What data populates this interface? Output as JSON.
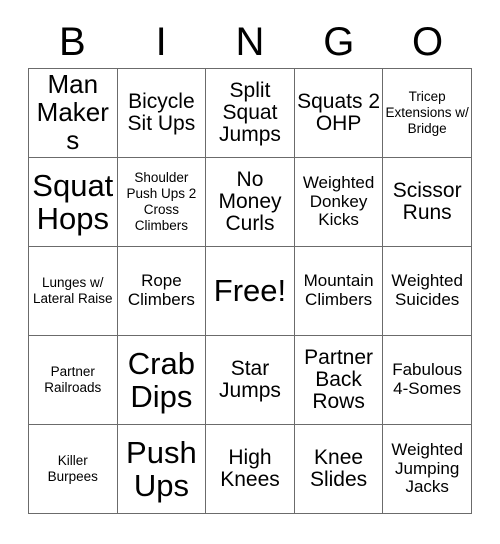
{
  "card": {
    "header_letters": [
      "B",
      "I",
      "N",
      "G",
      "O"
    ],
    "rows": [
      [
        {
          "label": "Man Makers",
          "size": "lg"
        },
        {
          "label": "Bicycle Sit Ups",
          "size": "md"
        },
        {
          "label": "Split Squat Jumps",
          "size": "md"
        },
        {
          "label": "Squats 2 OHP",
          "size": "md"
        },
        {
          "label": "Tricep Extensions w/ Bridge",
          "size": "xs"
        }
      ],
      [
        {
          "label": "Squat Hops",
          "size": "xl"
        },
        {
          "label": "Shoulder Push Ups 2 Cross Climbers",
          "size": "xs"
        },
        {
          "label": "No Money Curls",
          "size": "md"
        },
        {
          "label": "Weighted Donkey Kicks",
          "size": "sm"
        },
        {
          "label": "Scissor Runs",
          "size": "md"
        }
      ],
      [
        {
          "label": "Lunges w/ Lateral Raise",
          "size": "xs"
        },
        {
          "label": "Rope Climbers",
          "size": "sm"
        },
        {
          "label": "Free!",
          "size": "xl"
        },
        {
          "label": "Mountain Climbers",
          "size": "sm"
        },
        {
          "label": "Weighted Suicides",
          "size": "sm"
        }
      ],
      [
        {
          "label": "Partner Railroads",
          "size": "xs"
        },
        {
          "label": "Crab Dips",
          "size": "xl"
        },
        {
          "label": "Star Jumps",
          "size": "md"
        },
        {
          "label": "Partner Back Rows",
          "size": "md"
        },
        {
          "label": "Fabulous 4-Somes",
          "size": "sm"
        }
      ],
      [
        {
          "label": "Killer Burpees",
          "size": "xs"
        },
        {
          "label": "Push Ups",
          "size": "xl"
        },
        {
          "label": "High Knees",
          "size": "md"
        },
        {
          "label": "Knee Slides",
          "size": "md"
        },
        {
          "label": "Weighted Jumping Jacks",
          "size": "sm"
        }
      ]
    ]
  },
  "colors": {
    "border": "#6b6b6b",
    "text": "#000000",
    "background": "#ffffff"
  }
}
